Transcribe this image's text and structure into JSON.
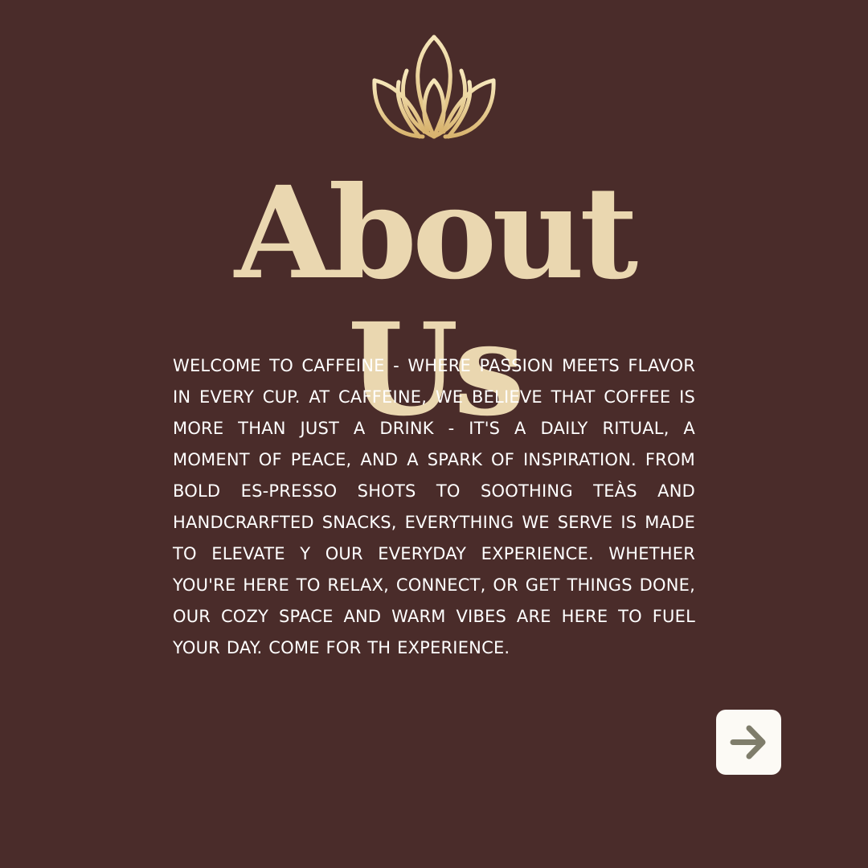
{
  "heading": {
    "title": "About Us"
  },
  "intro": {
    "text": "WELCOME TO CAFFEINE - WHERE PASSION MEETS FLAVOR IN EVERY CUP. AT CAFFEINE, WE BELIEVE THAT COFFEE IS MORE THAN JUST A DRINK - IT'S A DAILY RITUAL, A MOMENT OF PEACE, AND A SPARK OF INSPIRATION. FROM BOLD ES-PRESSO SHOTS TO SOOTHING TEÀS AND HANDCRARFTED SNACKS, EVERYTHING WE SERVE IS MADE TO ELEVATE Y OUR EVERYDAY EXPERIENCE. WHETHER YOU'RE HERE TO RELAX, CONNECT, OR GET THINGS DONE, OUR COZY SPACE AND WARM VIBES ARE HERE TO FUEL YOUR DAY. COME FOR TH EXPERIENCE."
  },
  "icons": {
    "logo": "lotus-icon",
    "next": "arrow-right-icon"
  },
  "colors": {
    "background": "#4a2c2a",
    "title": "#ead7b0",
    "body_text": "#ffffff",
    "logo_gold_light": "#f6e7bb",
    "logo_gold_dark": "#d8b36e",
    "button_bg": "#fcfaf5",
    "button_icon": "#7f7d6b"
  }
}
